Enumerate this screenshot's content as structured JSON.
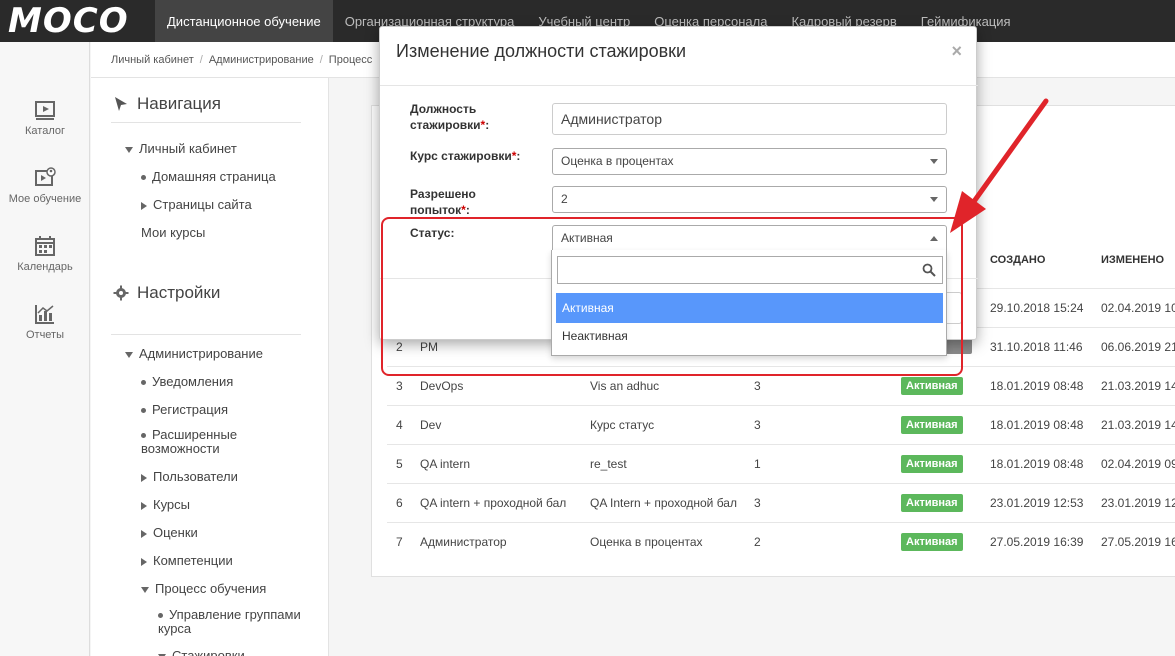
{
  "topbar": {
    "logo": "MOCO",
    "nav": [
      "Дистанционное обучение",
      "Организационная структура",
      "Учебный центр",
      "Оценка персонала",
      "Кадровый резерв",
      "Геймификация"
    ],
    "active_index": 0
  },
  "rail": [
    {
      "label": "Каталог",
      "icon": "catalog-icon"
    },
    {
      "label": "Мое обучение",
      "icon": "my-learning-icon"
    },
    {
      "label": "Календарь",
      "icon": "calendar-icon"
    },
    {
      "label": "Отчеты",
      "icon": "reports-icon"
    }
  ],
  "breadcrumb": [
    "Личный кабинет",
    "Администрирование",
    "Процесс"
  ],
  "sidemenu": {
    "nav_title": "Навигация",
    "settings_title": "Настройки",
    "personal": "Личный кабинет",
    "home": "Домашняя страница",
    "site_pages": "Страницы сайта",
    "my_courses": "Мои курсы",
    "admin": "Администрирование",
    "notifications": "Уведомления",
    "registration": "Регистрация",
    "extended": "Расширенные возможности",
    "users": "Пользователи",
    "courses": "Курсы",
    "grades": "Оценки",
    "competencies": "Компетенции",
    "learning_process": "Процесс обучения",
    "group_mgmt": "Управление группами курса",
    "internships": "Стажировки"
  },
  "table": {
    "headers": {
      "created": "СОЗДАНО",
      "modified": "ИЗМЕНЕНО"
    },
    "rows": [
      {
        "num": "",
        "name": "",
        "course": "",
        "attempts": "",
        "status": "",
        "created": "29.10.2018 15:24",
        "modified": "02.04.2019 10"
      },
      {
        "num": "2",
        "name": "PM",
        "course": "",
        "attempts": "",
        "status": "",
        "created": "31.10.2018 11:46",
        "modified": "06.06.2019 21"
      },
      {
        "num": "3",
        "name": "DevOps",
        "course": "Vis an adhuc",
        "attempts": "3",
        "status": "Активная",
        "created": "18.01.2019 08:48",
        "modified": "21.03.2019 14"
      },
      {
        "num": "4",
        "name": "Dev",
        "course": "Курс статус",
        "attempts": "3",
        "status": "Активная",
        "created": "18.01.2019 08:48",
        "modified": "21.03.2019 14"
      },
      {
        "num": "5",
        "name": "QA intern",
        "course": "re_test",
        "attempts": "1",
        "status": "Активная",
        "created": "18.01.2019 08:48",
        "modified": "02.04.2019 09"
      },
      {
        "num": "6",
        "name": "QA intern + проходной бал",
        "course": "QA Intern + проходной бал",
        "attempts": "3",
        "status": "Активная",
        "created": "23.01.2019 12:53",
        "modified": "23.01.2019 12"
      },
      {
        "num": "7",
        "name": "Администратор",
        "course": "Оценка в процентах",
        "attempts": "2",
        "status": "Активная",
        "created": "27.05.2019 16:39",
        "modified": "27.05.2019 16"
      }
    ]
  },
  "modal": {
    "title": "Изменение должности стажировки",
    "close": "×",
    "position_label_1": "Должность",
    "position_label_2": "стажировки",
    "position_value": "Администратор",
    "course_label": "Курс стажировки",
    "course_value": "Оценка в процентах",
    "attempts_label_1": "Разрешено",
    "attempts_label_2": "попыток",
    "attempts_value": "2",
    "status_label": "Статус:",
    "status_value": "Активная",
    "required_mark": "*",
    "colon": ":"
  },
  "dropdown": {
    "search_placeholder": "",
    "options": [
      "Активная",
      "Неактивная"
    ],
    "highlighted_index": 0
  },
  "colors": {
    "accent": "#5897fb",
    "badge": "#5cb85c",
    "annotation": "#e0242a",
    "topbar": "#2a2a2a"
  }
}
